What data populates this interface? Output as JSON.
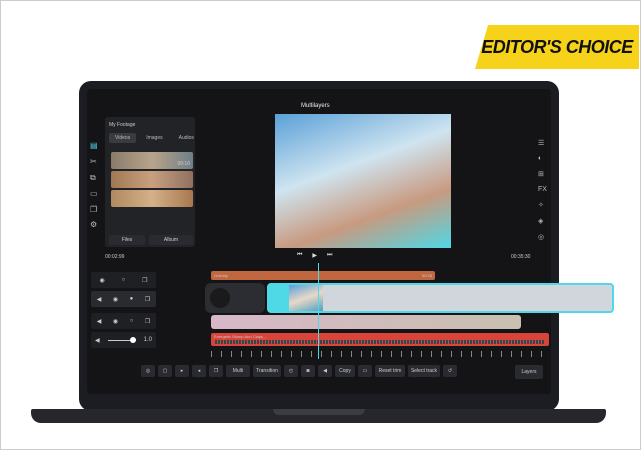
{
  "badge": "EDITOR'S CHOICE",
  "app": {
    "title": "Multilayers"
  },
  "footage": {
    "title": "My Footage",
    "tabs": [
      "Videos",
      "Images",
      "Audios"
    ],
    "clip_duration": "00:16",
    "files": "Files",
    "album": "Album"
  },
  "times": {
    "current": "00:02:99",
    "total": "00:35:30"
  },
  "timeline": {
    "overlay_label": "Overlay",
    "overlay_time": "00:26",
    "audio_label": "Energetic Stomp And Claps_..",
    "volume": "1.0"
  },
  "toolbar": {
    "multi": "Multi",
    "transition": "Transition",
    "copy": "Copy",
    "reset_trim": "Reset trim",
    "select_track": "Select track",
    "layers": "Layers"
  },
  "colors": {
    "accent": "#4fd8e6",
    "overlay": "#c0673f",
    "audio": "#d8433a",
    "badge": "#f7d21a"
  }
}
